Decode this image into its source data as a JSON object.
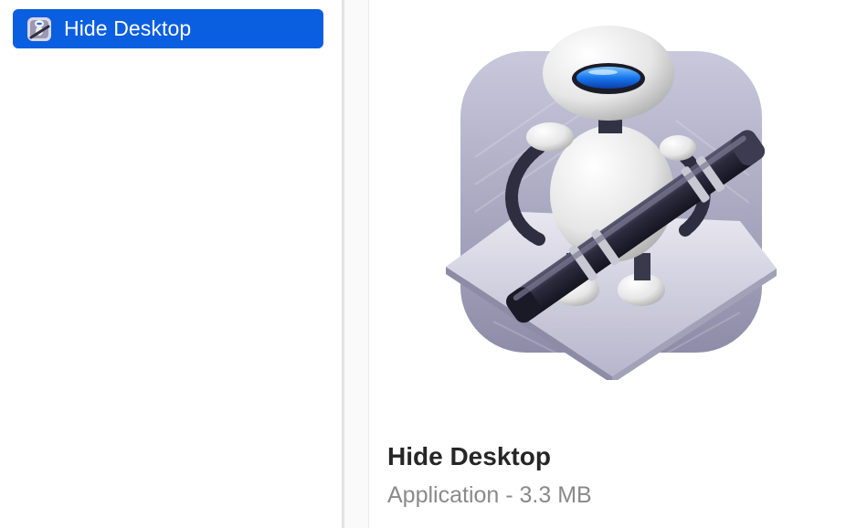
{
  "sidebar": {
    "items": [
      {
        "label": "Hide Desktop",
        "icon": "automator-icon",
        "selected": true
      }
    ]
  },
  "preview": {
    "title": "Hide Desktop",
    "kind_size": "Application - 3.3 MB",
    "icon": "automator-robot-icon"
  },
  "colors": {
    "selection": "#0a5ee0",
    "title_text": "#262626",
    "meta_text": "#8a8a8a"
  }
}
